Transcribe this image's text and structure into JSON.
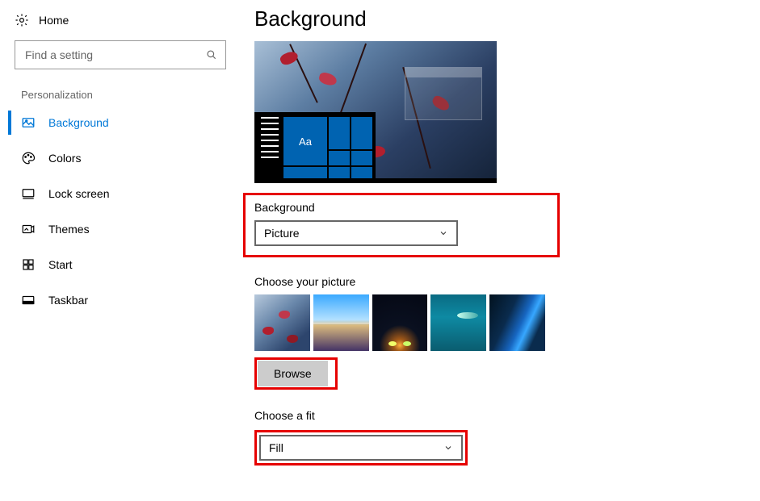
{
  "sidebar": {
    "home_label": "Home",
    "search_placeholder": "Find a setting",
    "section_title": "Personalization",
    "items": [
      {
        "label": "Background",
        "active": true
      },
      {
        "label": "Colors",
        "active": false
      },
      {
        "label": "Lock screen",
        "active": false
      },
      {
        "label": "Themes",
        "active": false
      },
      {
        "label": "Start",
        "active": false
      },
      {
        "label": "Taskbar",
        "active": false
      }
    ]
  },
  "main": {
    "page_title": "Background",
    "preview_tile_text": "Aa",
    "background_section": {
      "label": "Background",
      "dropdown_value": "Picture"
    },
    "choose_picture": {
      "label": "Choose your picture",
      "browse_label": "Browse"
    },
    "choose_fit": {
      "label": "Choose a fit",
      "dropdown_value": "Fill"
    }
  }
}
